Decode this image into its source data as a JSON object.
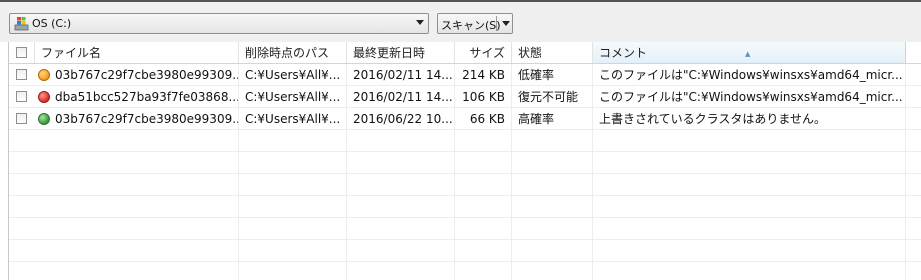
{
  "toolbar": {
    "drive_label": "OS (C:)",
    "scan_label": "スキャン(S)"
  },
  "columns": {
    "name": "ファイル名",
    "path": "削除時点のパス",
    "modified": "最終更新日時",
    "size": "サイズ",
    "state": "状態",
    "comment": "コメント"
  },
  "rows": [
    {
      "status_color": "#f5a623",
      "name": "03b767c29f7cbe3980e99309...",
      "path": "C:¥Users¥All¥...",
      "modified": "2016/02/11 14...",
      "size": "214 KB",
      "state": "低確率",
      "comment": "このファイルは\"C:¥Windows¥winsxs¥amd64_micr..."
    },
    {
      "status_color": "#e53935",
      "name": "dba51bcc527ba93f7fe03868...",
      "path": "C:¥Users¥All¥...",
      "modified": "2016/02/11 14...",
      "size": "106 KB",
      "state": "復元不可能",
      "comment": "このファイルは\"C:¥Windows¥winsxs¥amd64_micr..."
    },
    {
      "status_color": "#43a047",
      "name": "03b767c29f7cbe3980e99309...",
      "path": "C:¥Users¥All¥...",
      "modified": "2016/06/22 10...",
      "size": "66 KB",
      "state": "高確率",
      "comment": "上書きされているクラスタはありません。"
    }
  ]
}
